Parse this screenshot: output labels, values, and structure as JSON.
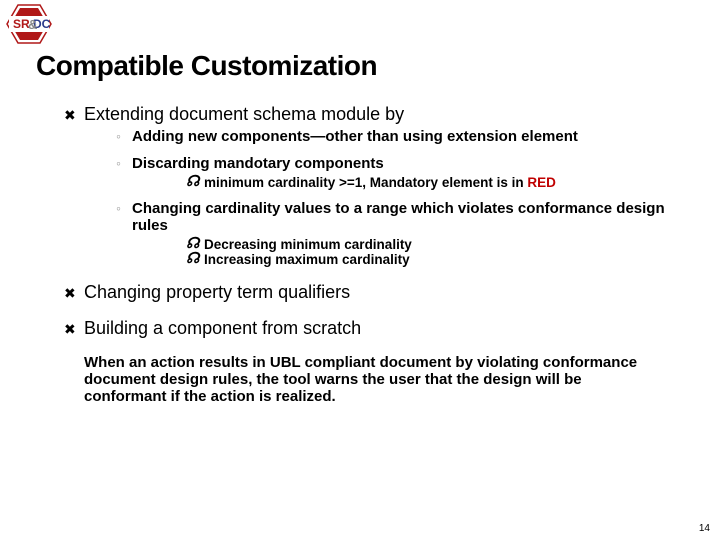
{
  "logo": {
    "top": "SR",
    "bottom": "DC"
  },
  "title": "Compatible Customization",
  "items": [
    {
      "text": "Extending document schema module by",
      "subs": [
        {
          "text": "Adding new components—other than using extension element"
        },
        {
          "text": "Discarding mandotary components",
          "subsubs": [
            {
              "prefix": "minimum cardinality >=1, Mandatory element is in ",
              "red": "RED"
            }
          ]
        },
        {
          "text": "Changing cardinality values to a range which violates conformance design rules",
          "subsubs": [
            {
              "prefix": "Decreasing minimum cardinality"
            },
            {
              "prefix": "Increasing maximum cardinality"
            }
          ]
        }
      ]
    },
    {
      "text": "Changing property term qualifiers"
    },
    {
      "text": "Building a component from scratch"
    }
  ],
  "paragraph": "When an action results in UBL compliant document by violating conformance document design rules, the tool warns the user that the design will be conformant if the action is realized.",
  "pageNumber": "14"
}
